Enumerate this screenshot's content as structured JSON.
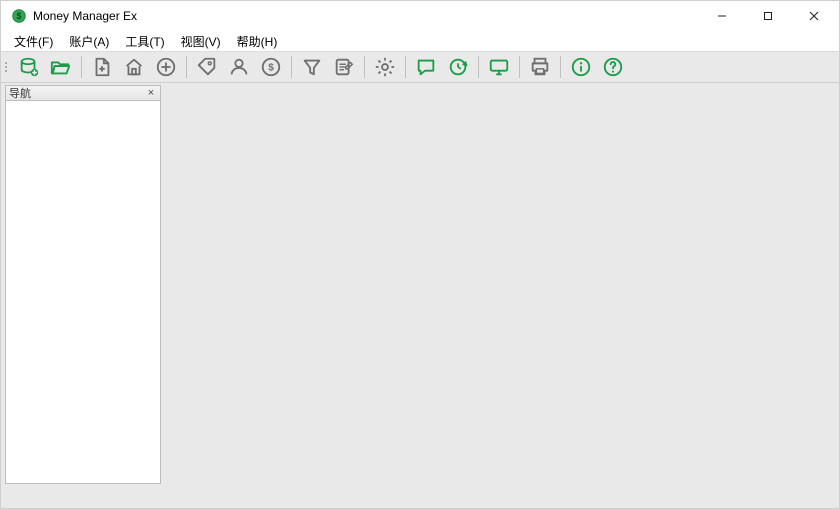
{
  "window": {
    "title": "Money Manager Ex"
  },
  "menu": {
    "items": [
      {
        "label": "文件(F)"
      },
      {
        "label": "账户(A)"
      },
      {
        "label": "工具(T)"
      },
      {
        "label": "视图(V)"
      },
      {
        "label": "帮助(H)"
      }
    ]
  },
  "toolbar": {
    "groups": [
      [
        "database-new",
        "folder-open"
      ],
      [
        "new-file",
        "home",
        "add-circle"
      ],
      [
        "tag",
        "person",
        "currency"
      ],
      [
        "filter",
        "edit-list"
      ],
      [
        "settings"
      ],
      [
        "comment",
        "refresh-clock"
      ],
      [
        "monitor"
      ],
      [
        "print"
      ],
      [
        "info",
        "help"
      ]
    ],
    "primary_color": "#1b9c49",
    "neutral_color": "#6f6f6f"
  },
  "nav": {
    "title": "导航",
    "close_glyph": "×"
  }
}
